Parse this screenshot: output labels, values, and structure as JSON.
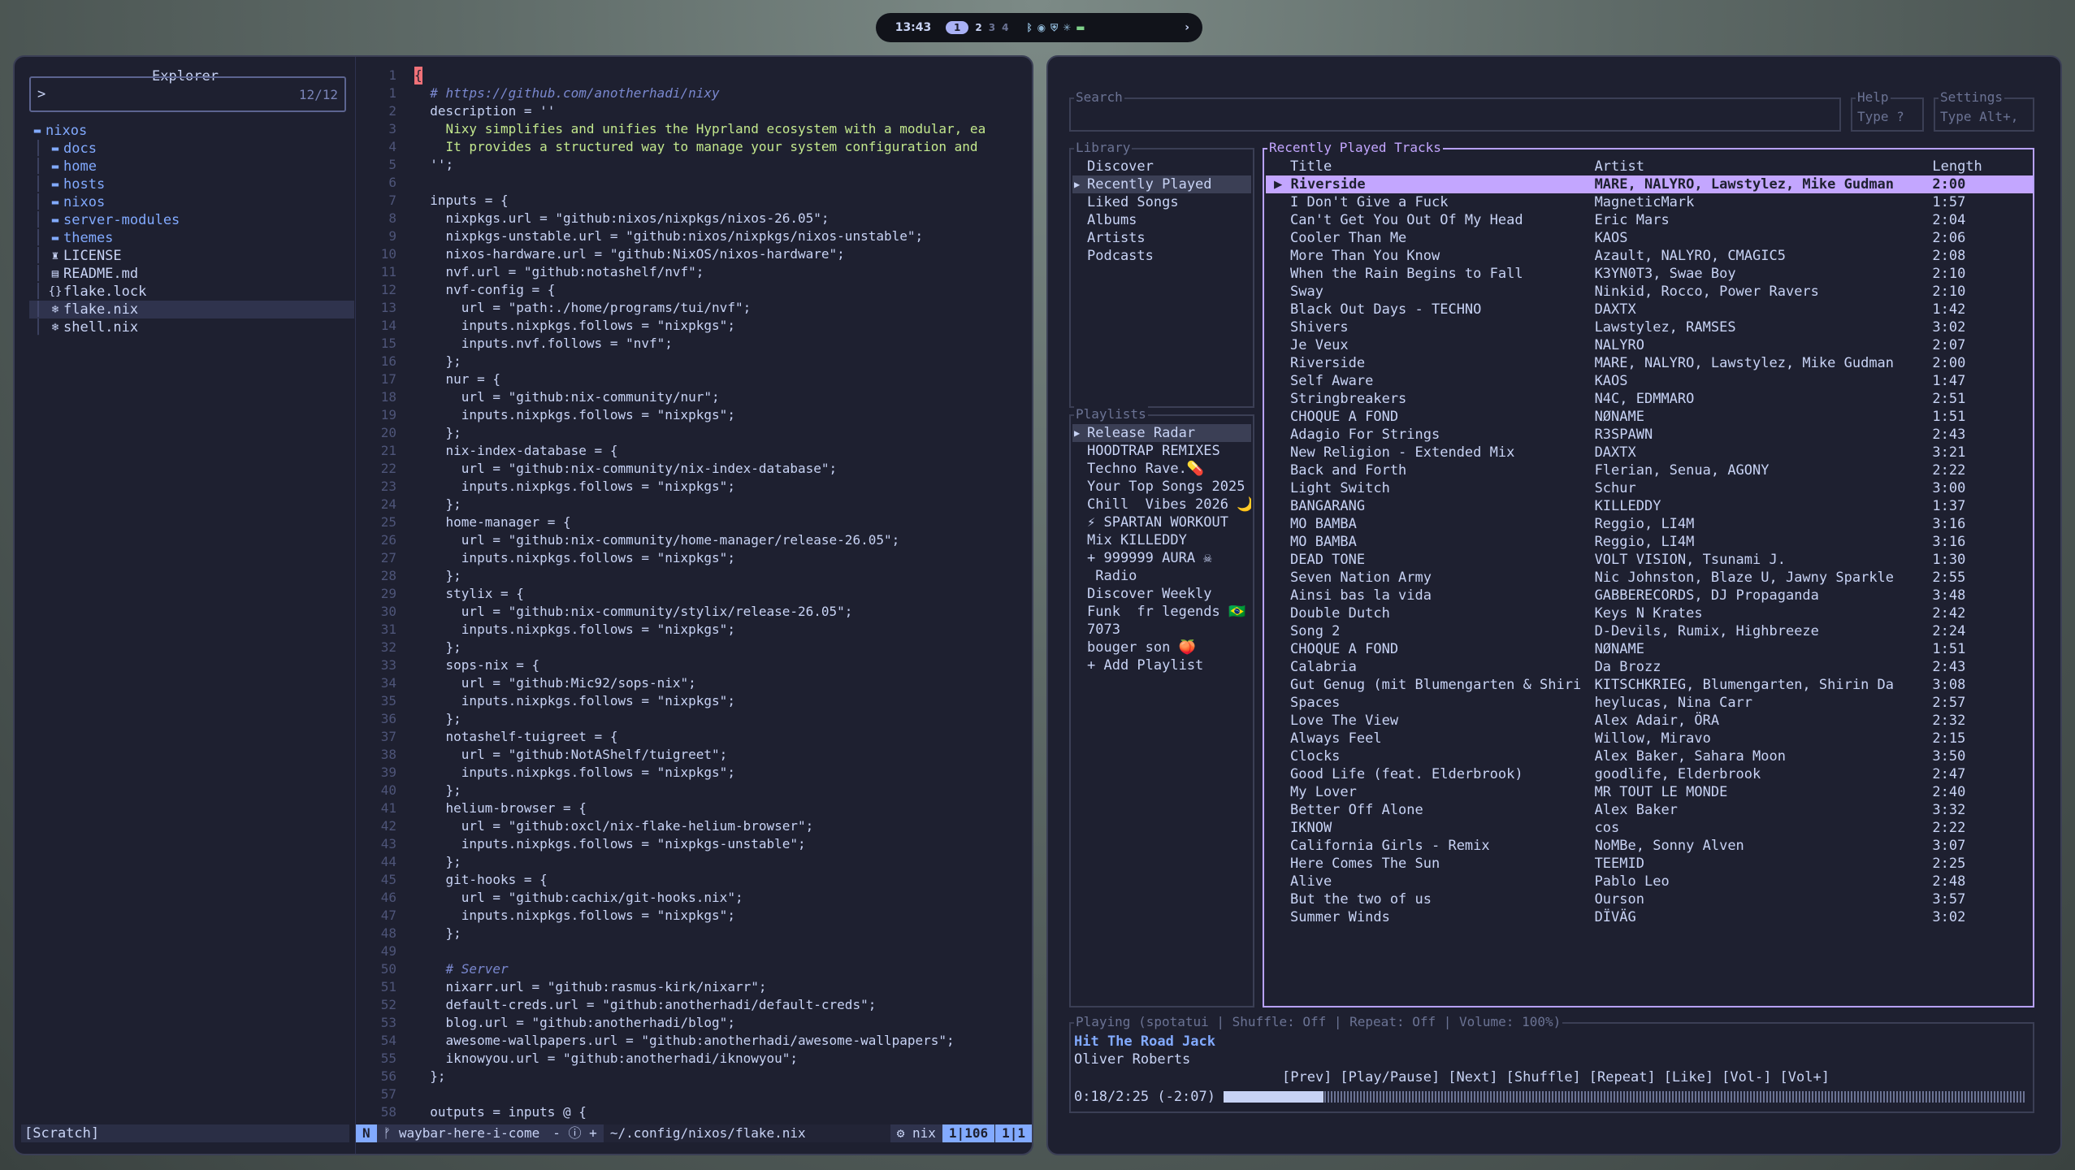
{
  "topbar": {
    "clock": "13:43",
    "workspaces": [
      "1",
      "2",
      "3",
      "4"
    ],
    "active_workspace": "1",
    "tray_icons": [
      "bluetooth-icon",
      "wifi-icon",
      "shield-icon",
      "cpu-icon",
      "battery-icon"
    ],
    "arrow": "›"
  },
  "explorer": {
    "title": "Explorer",
    "prompt": ">",
    "count": "12/12",
    "tree": [
      {
        "depth": 0,
        "type": "folder",
        "name": "nixos"
      },
      {
        "depth": 1,
        "type": "folder",
        "name": "docs"
      },
      {
        "depth": 1,
        "type": "folder",
        "name": "home"
      },
      {
        "depth": 1,
        "type": "folder",
        "name": "hosts"
      },
      {
        "depth": 1,
        "type": "folder",
        "name": "nixos"
      },
      {
        "depth": 1,
        "type": "folder",
        "name": "server-modules"
      },
      {
        "depth": 1,
        "type": "folder",
        "name": "themes"
      },
      {
        "depth": 1,
        "type": "file",
        "name": "LICENSE"
      },
      {
        "depth": 1,
        "type": "file",
        "name": "README.md"
      },
      {
        "depth": 1,
        "type": "file",
        "name": "flake.lock"
      },
      {
        "depth": 1,
        "type": "file",
        "name": "flake.nix",
        "selected": true
      },
      {
        "depth": 1,
        "type": "file",
        "name": "shell.nix"
      }
    ],
    "scratch": "[Scratch]"
  },
  "code": {
    "lines": [
      {
        "n": "1",
        "t": "{",
        "k": "txt"
      },
      {
        "n": "1",
        "t": "  # https://github.com/anotherhadi/nixy",
        "k": "comment"
      },
      {
        "n": "2",
        "t": "  description = ''",
        "k": "txt"
      },
      {
        "n": "3",
        "t": "    Nixy simplifies and unifies the Hyprland ecosystem with a modular, ea",
        "k": "str"
      },
      {
        "n": "4",
        "t": "    It provides a structured way to manage your system configuration and",
        "k": "str"
      },
      {
        "n": "5",
        "t": "  '';",
        "k": "txt"
      },
      {
        "n": "6",
        "t": "",
        "k": "txt"
      },
      {
        "n": "7",
        "t": "  inputs = {",
        "k": "txt"
      },
      {
        "n": "8",
        "t": "    nixpkgs.url = \"github:nixos/nixpkgs/nixos-26.05\";",
        "k": "txt"
      },
      {
        "n": "9",
        "t": "    nixpkgs-unstable.url = \"github:nixos/nixpkgs/nixos-unstable\";",
        "k": "txt"
      },
      {
        "n": "10",
        "t": "    nixos-hardware.url = \"github:NixOS/nixos-hardware\";",
        "k": "txt"
      },
      {
        "n": "11",
        "t": "    nvf.url = \"github:notashelf/nvf\";",
        "k": "txt"
      },
      {
        "n": "12",
        "t": "    nvf-config = {",
        "k": "txt"
      },
      {
        "n": "13",
        "t": "      url = \"path:./home/programs/tui/nvf\";",
        "k": "txt"
      },
      {
        "n": "14",
        "t": "      inputs.nixpkgs.follows = \"nixpkgs\";",
        "k": "txt"
      },
      {
        "n": "15",
        "t": "      inputs.nvf.follows = \"nvf\";",
        "k": "txt"
      },
      {
        "n": "16",
        "t": "    };",
        "k": "txt"
      },
      {
        "n": "17",
        "t": "    nur = {",
        "k": "txt"
      },
      {
        "n": "18",
        "t": "      url = \"github:nix-community/nur\";",
        "k": "txt"
      },
      {
        "n": "19",
        "t": "      inputs.nixpkgs.follows = \"nixpkgs\";",
        "k": "txt"
      },
      {
        "n": "20",
        "t": "    };",
        "k": "txt"
      },
      {
        "n": "21",
        "t": "    nix-index-database = {",
        "k": "txt"
      },
      {
        "n": "22",
        "t": "      url = \"github:nix-community/nix-index-database\";",
        "k": "txt"
      },
      {
        "n": "23",
        "t": "      inputs.nixpkgs.follows = \"nixpkgs\";",
        "k": "txt"
      },
      {
        "n": "24",
        "t": "    };",
        "k": "txt"
      },
      {
        "n": "25",
        "t": "    home-manager = {",
        "k": "txt"
      },
      {
        "n": "26",
        "t": "      url = \"github:nix-community/home-manager/release-26.05\";",
        "k": "txt"
      },
      {
        "n": "27",
        "t": "      inputs.nixpkgs.follows = \"nixpkgs\";",
        "k": "txt"
      },
      {
        "n": "28",
        "t": "    };",
        "k": "txt"
      },
      {
        "n": "29",
        "t": "    stylix = {",
        "k": "txt"
      },
      {
        "n": "30",
        "t": "      url = \"github:nix-community/stylix/release-26.05\";",
        "k": "txt"
      },
      {
        "n": "31",
        "t": "      inputs.nixpkgs.follows = \"nixpkgs\";",
        "k": "txt"
      },
      {
        "n": "32",
        "t": "    };",
        "k": "txt"
      },
      {
        "n": "33",
        "t": "    sops-nix = {",
        "k": "txt"
      },
      {
        "n": "34",
        "t": "      url = \"github:Mic92/sops-nix\";",
        "k": "txt"
      },
      {
        "n": "35",
        "t": "      inputs.nixpkgs.follows = \"nixpkgs\";",
        "k": "txt"
      },
      {
        "n": "36",
        "t": "    };",
        "k": "txt"
      },
      {
        "n": "37",
        "t": "    notashelf-tuigreet = {",
        "k": "txt"
      },
      {
        "n": "38",
        "t": "      url = \"github:NotAShelf/tuigreet\";",
        "k": "txt"
      },
      {
        "n": "39",
        "t": "      inputs.nixpkgs.follows = \"nixpkgs\";",
        "k": "txt"
      },
      {
        "n": "40",
        "t": "    };",
        "k": "txt"
      },
      {
        "n": "41",
        "t": "    helium-browser = {",
        "k": "txt"
      },
      {
        "n": "42",
        "t": "      url = \"github:oxcl/nix-flake-helium-browser\";",
        "k": "txt"
      },
      {
        "n": "43",
        "t": "      inputs.nixpkgs.follows = \"nixpkgs-unstable\";",
        "k": "txt"
      },
      {
        "n": "44",
        "t": "    };",
        "k": "txt"
      },
      {
        "n": "45",
        "t": "    git-hooks = {",
        "k": "txt"
      },
      {
        "n": "46",
        "t": "      url = \"github:cachix/git-hooks.nix\";",
        "k": "txt"
      },
      {
        "n": "47",
        "t": "      inputs.nixpkgs.follows = \"nixpkgs\";",
        "k": "txt"
      },
      {
        "n": "48",
        "t": "    };",
        "k": "txt"
      },
      {
        "n": "49",
        "t": "",
        "k": "txt"
      },
      {
        "n": "50",
        "t": "    # Server",
        "k": "comment"
      },
      {
        "n": "51",
        "t": "    nixarr.url = \"github:rasmus-kirk/nixarr\";",
        "k": "txt"
      },
      {
        "n": "52",
        "t": "    default-creds.url = \"github:anotherhadi/default-creds\";",
        "k": "txt"
      },
      {
        "n": "53",
        "t": "    blog.url = \"github:anotherhadi/blog\";",
        "k": "txt"
      },
      {
        "n": "54",
        "t": "    awesome-wallpapers.url = \"github:anotherhadi/awesome-wallpapers\";",
        "k": "txt"
      },
      {
        "n": "55",
        "t": "    iknowyou.url = \"github:anotherhadi/iknowyou\";",
        "k": "txt"
      },
      {
        "n": "56",
        "t": "  };",
        "k": "txt"
      },
      {
        "n": "57",
        "t": "",
        "k": "txt"
      },
      {
        "n": "58",
        "t": "  outputs = inputs @ {",
        "k": "txt"
      }
    ]
  },
  "statusline": {
    "mode": "N",
    "branch": "waybar-here-i-come",
    "diag": "- ⓘ +",
    "path": "~/.config/nixos/flake.nix",
    "filetype": "nix",
    "position": "1|106",
    "column": "1|1"
  },
  "spotify": {
    "search_caption": "Search",
    "help_caption": "Help",
    "help_placeholder": "Type ?",
    "settings_caption": "Settings",
    "settings_placeholder": "Type Alt+,",
    "library_caption": "Library",
    "library": [
      "Discover",
      "Recently Played",
      "Liked Songs",
      "Albums",
      "Artists",
      "Podcasts"
    ],
    "library_selected": 1,
    "playlists_caption": "Playlists",
    "playlists": [
      "Release Radar",
      "HOODTRAP REMIXES",
      "Techno Rave.💊",
      "Your Top Songs 2025",
      "Chill  Vibes 2026 🌙",
      "⚡ SPARTAN WORKOUT",
      "Mix KILLEDDY",
      "+ 999999 AURA ☠",
      " Radio",
      "Discover Weekly",
      "Funk  fr legends 🇧🇷",
      "7073",
      "bouger son 🍑",
      "+ Add Playlist"
    ],
    "playlists_selected": 0,
    "tracks_caption": "Recently Played Tracks",
    "columns": [
      "Title",
      "Artist",
      "Length"
    ],
    "tracks": [
      [
        "Riverside",
        "MARE, NALYRO, Lawstylez, Mike Gudman",
        "2:00"
      ],
      [
        "I Don't Give a Fuck",
        "MagneticMark",
        "1:57"
      ],
      [
        "Can't Get You Out Of My Head",
        "Eric Mars",
        "2:04"
      ],
      [
        "Cooler Than Me",
        "KAOS",
        "2:06"
      ],
      [
        "More Than You Know",
        "Azault, NALYRO, CMAGIC5",
        "2:08"
      ],
      [
        "When the Rain Begins to Fall",
        "K3YN0T3, Swae Boy",
        "2:10"
      ],
      [
        "Sway",
        "Ninkid, Rocco, Power Ravers",
        "2:10"
      ],
      [
        "Black Out Days - TECHNO",
        "DAXTX",
        "1:42"
      ],
      [
        "Shivers",
        "Lawstylez, RAMSES",
        "3:02"
      ],
      [
        "Je Veux",
        "NALYRO",
        "2:07"
      ],
      [
        "Riverside",
        "MARE, NALYRO, Lawstylez, Mike Gudman",
        "2:00"
      ],
      [
        "Self Aware",
        "KAOS",
        "1:47"
      ],
      [
        "Stringbreakers",
        "N4C, EDMMARO",
        "2:51"
      ],
      [
        "CHOQUE A FOND",
        "NØNAME",
        "1:51"
      ],
      [
        "Adagio For Strings",
        "R3SPAWN",
        "2:43"
      ],
      [
        "New Religion - Extended Mix",
        "DAXTX",
        "3:21"
      ],
      [
        "Back and Forth",
        "Flerian, Senua, AGONY",
        "2:22"
      ],
      [
        "Light Switch",
        "Schur",
        "3:00"
      ],
      [
        "BANGARANG",
        "KILLEDDY",
        "1:37"
      ],
      [
        "MO BAMBA",
        "Reggio, LI4M",
        "3:16"
      ],
      [
        "MO BAMBA",
        "Reggio, LI4M",
        "3:16"
      ],
      [
        "DEAD TONE",
        "VOLT VISION, Tsunami J.",
        "1:30"
      ],
      [
        "Seven Nation Army",
        "Nic Johnston, Blaze U, Jawny Sparkle",
        "2:55"
      ],
      [
        "Ainsi bas la vida",
        "GABBERECORDS, DJ Propaganda",
        "3:48"
      ],
      [
        "Double Dutch",
        "Keys N Krates",
        "2:42"
      ],
      [
        "Song 2",
        "D-Devils, Rumix, Highbreeze",
        "2:24"
      ],
      [
        "CHOQUE A FOND",
        "NØNAME",
        "1:51"
      ],
      [
        "Calabria",
        "Da Brozz",
        "2:43"
      ],
      [
        "Gut Genug (mit Blumengarten & Shiri",
        "KITSCHKRIEG, Blumengarten, Shirin Da",
        "3:08"
      ],
      [
        "Spaces",
        "heylucas, Nina Carr",
        "2:57"
      ],
      [
        "Love The View",
        "Alex Adair, ÖRA",
        "2:32"
      ],
      [
        "Always Feel",
        "Willow, Miravo",
        "2:15"
      ],
      [
        "Clocks",
        "Alex Baker, Sahara Moon",
        "3:50"
      ],
      [
        "Good Life (feat. Elderbrook)",
        "goodlife, Elderbrook",
        "2:47"
      ],
      [
        "My Lover",
        "MR TOUT LE MONDE",
        "2:40"
      ],
      [
        "Better Off Alone",
        "Alex Baker",
        "3:32"
      ],
      [
        "IKNOW",
        "cos",
        "2:22"
      ],
      [
        "California Girls - Remix",
        "NoMBe, Sonny Alven",
        "3:07"
      ],
      [
        "Here Comes The Sun",
        "TEEMID",
        "2:25"
      ],
      [
        "Alive",
        "Pablo Leo",
        "2:48"
      ],
      [
        "But the two of us",
        "Ourson",
        "3:57"
      ],
      [
        "Summer Winds",
        "DÏVÄG",
        "3:02"
      ]
    ],
    "playing_index": 0,
    "player_caption": "Playing (spotatui | Shuffle: Off | Repeat: Off   | Volume: 100%)",
    "now_title": "Hit The Road Jack",
    "now_artist": "Oliver Roberts",
    "controls": [
      "[Prev]",
      "[Play/Pause]",
      "[Next]",
      "[Shuffle]",
      "[Repeat]",
      "[Like]",
      "[Vol-]",
      "[Vol+]"
    ],
    "time": "0:18/2:25 (-2:07)",
    "progress_fraction": 0.124
  },
  "colors": {
    "accent": "#82aaff",
    "playing_row": "#c3a6ff",
    "string": "#c3e88d"
  }
}
